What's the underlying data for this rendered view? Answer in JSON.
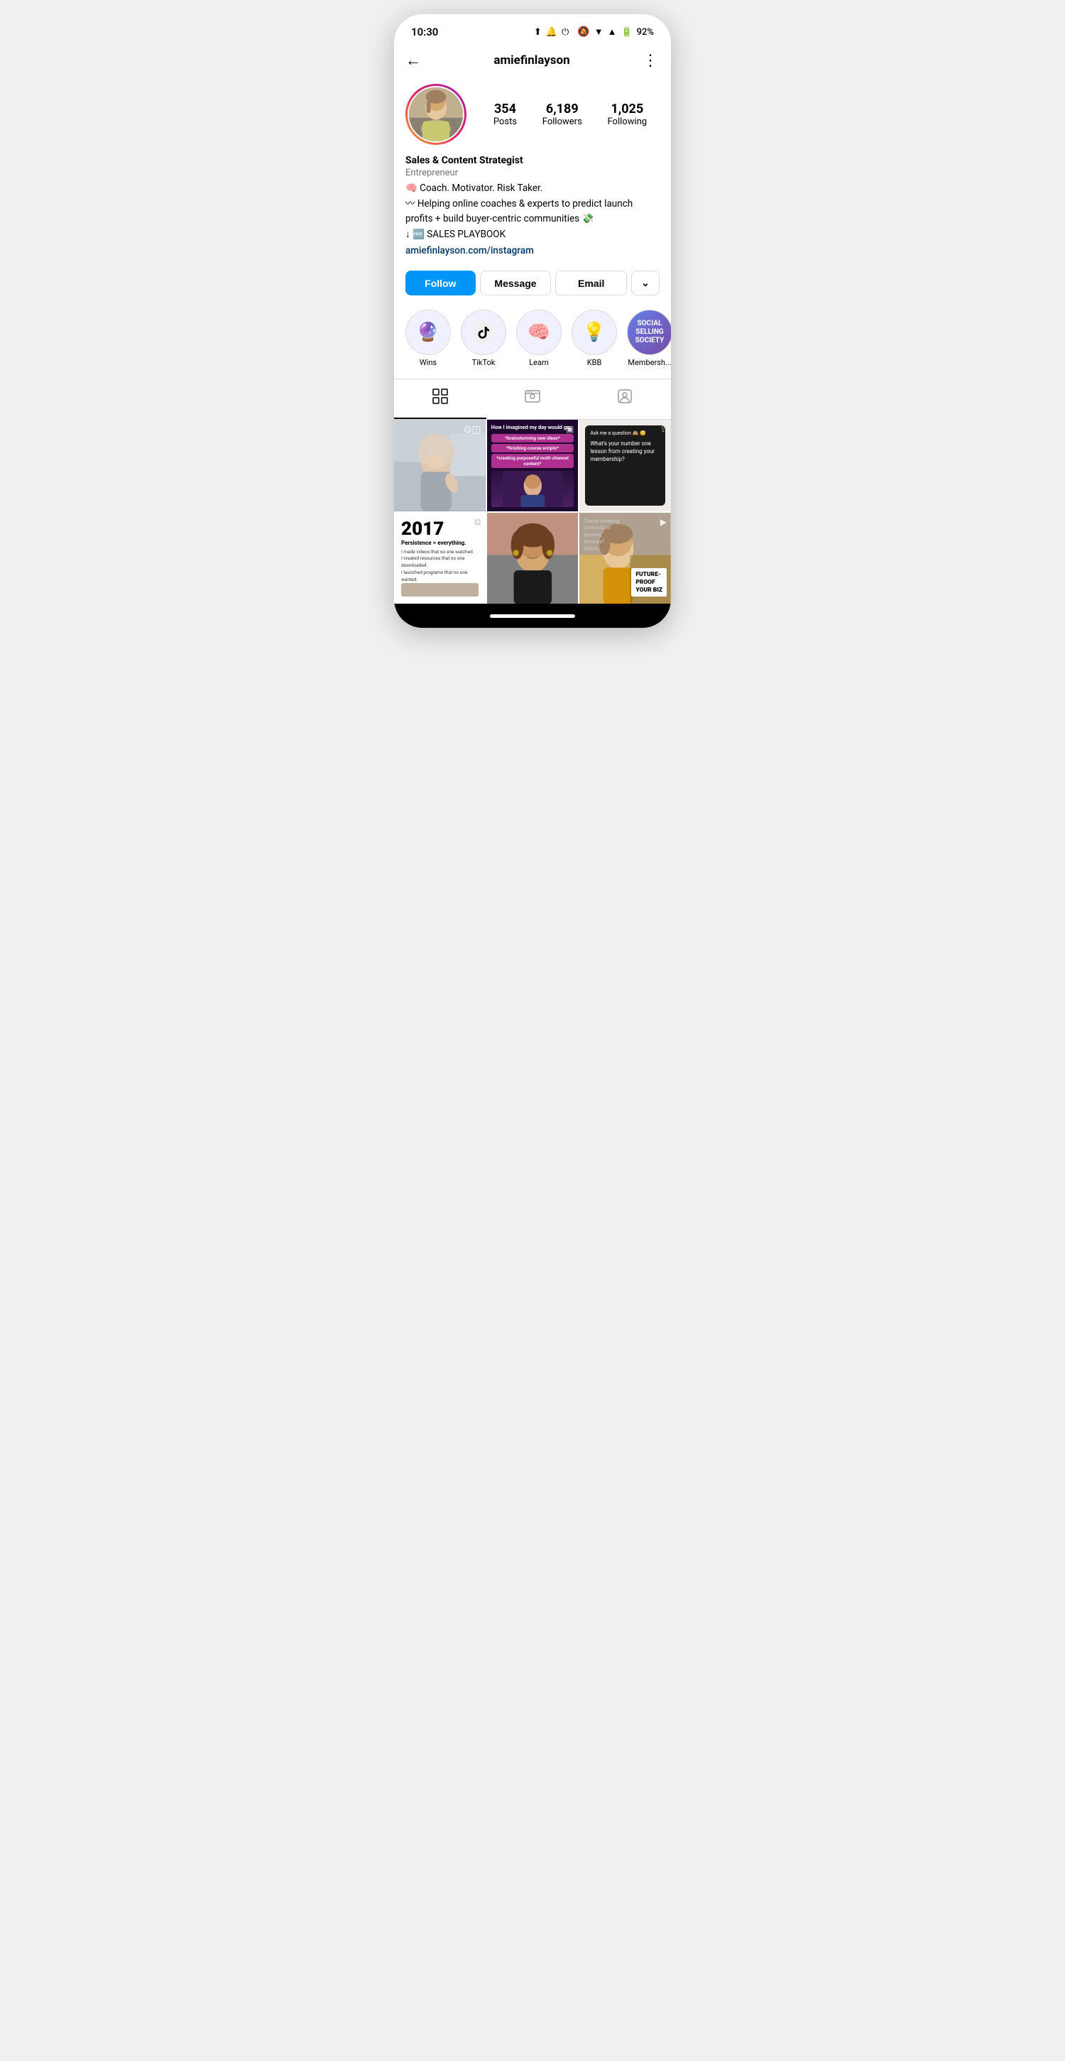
{
  "status_bar": {
    "time": "10:30",
    "battery": "92%",
    "icons": [
      "upload-icon",
      "bell-icon",
      "power-icon",
      "mute-icon",
      "wifi-icon",
      "signal-icon",
      "battery-icon"
    ]
  },
  "nav": {
    "username": "amiefinlayson",
    "back_label": "←",
    "more_label": "⋮"
  },
  "profile": {
    "stats": {
      "posts_count": "354",
      "posts_label": "Posts",
      "followers_count": "6,189",
      "followers_label": "Followers",
      "following_count": "1,025",
      "following_label": "Following"
    },
    "bio_name": "Sales & Content Strategist",
    "bio_category": "Entrepreneur",
    "bio_line1": "🧠 Coach. Motivator. Risk Taker.",
    "bio_line2": "〰 Helping online coaches & experts to predict launch profits + build buyer-centric communities 💸",
    "bio_line3": "↓ 🆓 SALES PLAYBOOK",
    "bio_link": "amiefinlayson.com/instagram"
  },
  "buttons": {
    "follow": "Follow",
    "message": "Message",
    "email": "Email",
    "dropdown": "⌄"
  },
  "highlights": [
    {
      "id": "wins",
      "label": "Wins",
      "icon": "🔮"
    },
    {
      "id": "tiktok",
      "label": "TikTok",
      "icon": "♪"
    },
    {
      "id": "learn",
      "label": "Learn",
      "icon": "🧠"
    },
    {
      "id": "kbb",
      "label": "KBB",
      "icon": "💡"
    },
    {
      "id": "membership",
      "label": "Membersh...",
      "icon": "society"
    }
  ],
  "tabs": [
    {
      "id": "grid",
      "label": "Grid",
      "active": true
    },
    {
      "id": "reels",
      "label": "Reels",
      "active": false
    },
    {
      "id": "tagged",
      "label": "Tagged",
      "active": false
    }
  ],
  "posts": [
    {
      "id": "post1",
      "type": "video",
      "desc": "Woman talking to camera in gray top"
    },
    {
      "id": "post2",
      "type": "image",
      "title": "How I imagined my day would go:",
      "pills": [
        "*brainstorming new ideas*",
        "*finishing course scripts*",
        "*creating purposeful multi-channel content*"
      ],
      "desc": "Woman with dark hair on purple background"
    },
    {
      "id": "post3",
      "type": "image",
      "ask_label": "Ask me a question 🙈 😴",
      "ask_question": "What's your number one lesson from creating your membership?"
    },
    {
      "id": "post4",
      "type": "image",
      "year": "2017",
      "subtitle": "Persistence = everything.",
      "body": "I made videos that no one watched.\nI created resources that no one downloaded.\nI launched programs that no one wanted."
    },
    {
      "id": "post5",
      "type": "image",
      "desc": "Woman with brown hair smiling"
    },
    {
      "id": "post6",
      "type": "video",
      "clients_text": "Clients breaking contracts or pausing services? Watch...",
      "future_proof": "FUTURE-\nPROOF\nYOUR BIZ"
    }
  ]
}
